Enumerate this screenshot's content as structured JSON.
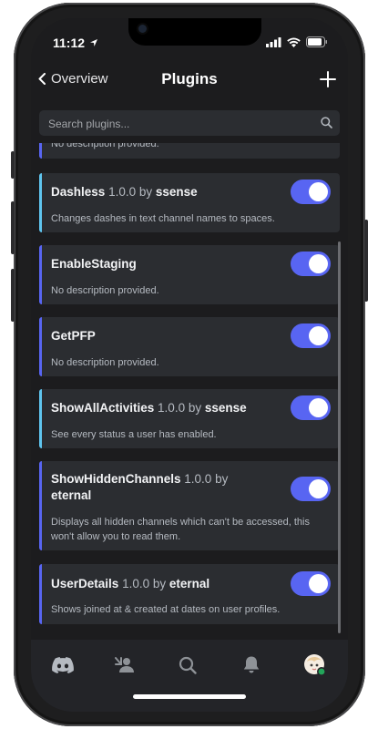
{
  "status_bar": {
    "time": "11:12"
  },
  "nav": {
    "back_label": "Overview",
    "title": "Plugins"
  },
  "search": {
    "placeholder": "Search plugins..."
  },
  "partial_item": {
    "description": "No description provided."
  },
  "plugins": [
    {
      "name": "Dashless",
      "version": "1.0.0",
      "by": "by",
      "author": "ssense",
      "description": "Changes dashes in text channel names to spaces.",
      "accent": "#5fc5ef",
      "enabled": true
    },
    {
      "name": "EnableStaging",
      "version": "",
      "by": "",
      "author": "",
      "description": "No description provided.",
      "accent": "#5865f2",
      "enabled": true
    },
    {
      "name": "GetPFP",
      "version": "",
      "by": "",
      "author": "",
      "description": "No description provided.",
      "accent": "#5865f2",
      "enabled": true
    },
    {
      "name": "ShowAllActivities",
      "version": "1.0.0",
      "by": "by",
      "author": "ssense",
      "description": "See every status a user has enabled.",
      "accent": "#5fc5ef",
      "enabled": true
    },
    {
      "name": "ShowHiddenChannels",
      "version": "1.0.0",
      "by": "by",
      "author": "eternal",
      "description": "Displays all hidden channels which can't be accessed, this won't allow you to read them.",
      "accent": "#5865f2",
      "enabled": true
    },
    {
      "name": "UserDetails",
      "version": "1.0.0",
      "by": "by",
      "author": "eternal",
      "description": "Shows joined at & created at dates on user profiles.",
      "accent": "#5865f2",
      "enabled": true
    }
  ],
  "tabbar": {
    "items": [
      "discord-home-icon",
      "friends-icon",
      "search-icon",
      "notifications-icon",
      "profile-avatar"
    ],
    "online_color": "#23a55a"
  },
  "colors": {
    "toggle_on": "#5865f2",
    "card_bg": "#2b2d31",
    "screen_bg": "#1c1c1e"
  }
}
